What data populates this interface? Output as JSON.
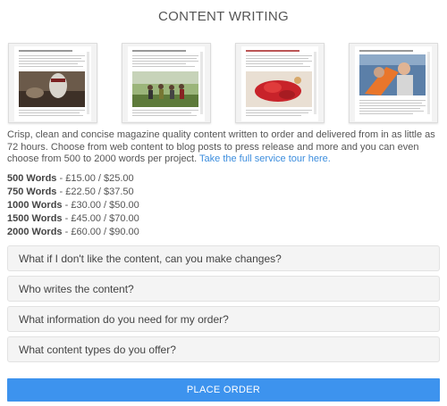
{
  "page": {
    "title": "CONTENT WRITING"
  },
  "samples": [
    {
      "name": "sample-article-1"
    },
    {
      "name": "sample-article-2"
    },
    {
      "name": "sample-article-3"
    },
    {
      "name": "sample-article-4"
    }
  ],
  "description": {
    "text": "Crisp, clean and concise magazine quality content written to order and delivered from in as little as 72 hours. Choose from web content to blog posts to press release and more and you can even choose from 500 to 2000 words per project.",
    "link": "Take the full service tour here."
  },
  "pricing": [
    {
      "words": "500 Words",
      "price": " - £15.00 / $25.00"
    },
    {
      "words": "750 Words",
      "price": " - £22.50 / $37.50"
    },
    {
      "words": "1000 Words",
      "price": " - £30.00 / $50.00"
    },
    {
      "words": "1500 Words",
      "price": " - £45.00 / $70.00"
    },
    {
      "words": "2000 Words",
      "price": " - £60.00 / $90.00"
    }
  ],
  "faq": [
    {
      "question": "What if I don't like the content, can you make changes?"
    },
    {
      "question": "Who writes the content?"
    },
    {
      "question": "What information do you need for my order?"
    },
    {
      "question": "What content types do you offer?"
    }
  ],
  "cta": {
    "label": "PLACE ORDER"
  },
  "colors": {
    "accent": "#3d93ee",
    "link": "#3d8ede"
  }
}
